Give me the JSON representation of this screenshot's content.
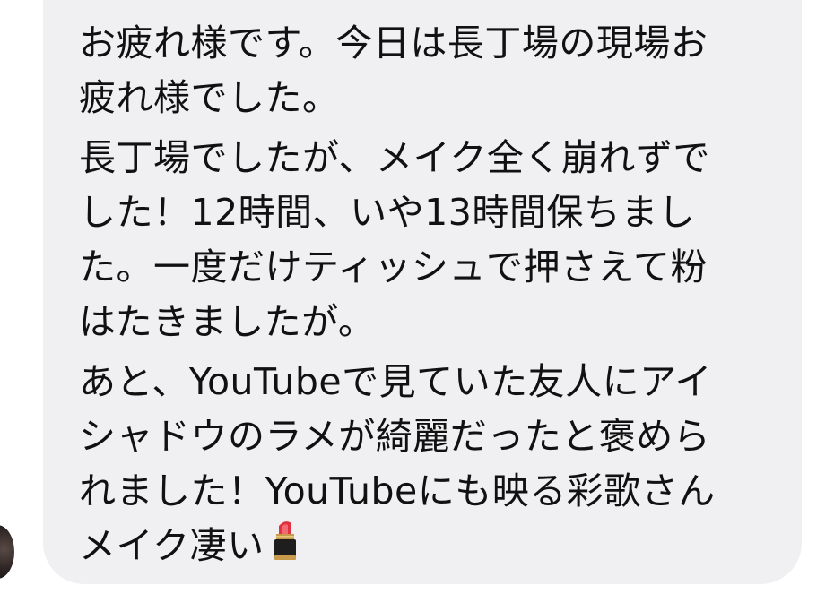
{
  "message": {
    "paragraphs": [
      {
        "lines": [
          "お疲れ様です。今日は長丁場の現場お",
          "疲れ様でした。"
        ]
      },
      {
        "lines": [
          "長丁場でしたが、メイク全く崩れずで",
          "した！12時間、いや13時間保ちまし",
          "た。一度だけティッシュで押さえて粉",
          "はたきましたが。"
        ]
      },
      {
        "lines": [
          "あと、YouTubeで見ていた友人にアイ",
          "シャドウのラメが綺麗だったと褒めら",
          "れました！YouTubeにも映る彩歌さん",
          "メイク凄い"
        ]
      }
    ],
    "trailing_emoji": "lipstick-emoji"
  }
}
